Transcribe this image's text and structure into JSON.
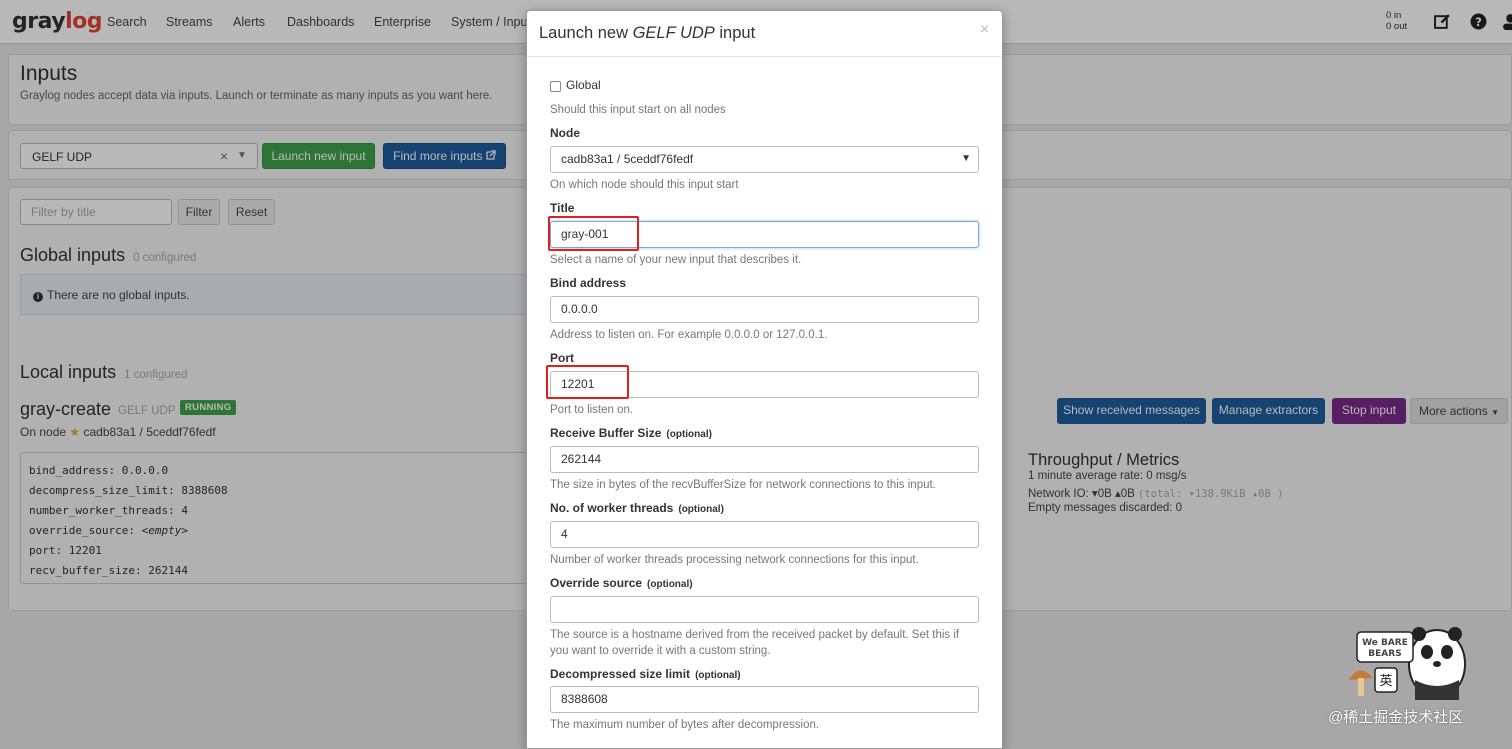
{
  "navbar": {
    "logo_gray": "gray",
    "logo_log": "log",
    "items": [
      "Search",
      "Streams",
      "Alerts",
      "Dashboards",
      "Enterprise",
      "System / Inputs"
    ],
    "throughput_in": "0 in",
    "throughput_out": "0 out",
    "icons": [
      "edit-icon",
      "help-icon",
      "user-icon"
    ]
  },
  "page": {
    "title": "Inputs",
    "description": "Graylog nodes accept data via inputs. Launch or terminate as many inputs as you want here."
  },
  "launcher": {
    "selected_input": "GELF UDP",
    "clear_glyph": "×",
    "launch_label": "Launch new input",
    "find_label": "Find more inputs"
  },
  "filter": {
    "placeholder": "Filter by title",
    "filter_label": "Filter",
    "reset_label": "Reset"
  },
  "global_inputs": {
    "title": "Global inputs",
    "count": "0 configured",
    "empty_message": "There are no global inputs."
  },
  "local_inputs": {
    "title": "Local inputs",
    "count": "1 configured"
  },
  "input": {
    "name": "gray-create",
    "type": "GELF UDP",
    "status": "RUNNING",
    "on_node_prefix": "On node",
    "node": "cadb83a1 / 5ceddf76fedf",
    "config": [
      {
        "text": "bind_address: 0.0.0.0"
      },
      {
        "text": "decompress_size_limit: 8388608"
      },
      {
        "text": "number_worker_threads: 4"
      },
      {
        "text": "override_source: ",
        "italic": "<empty>"
      },
      {
        "text": "port: 12201"
      },
      {
        "text": "recv_buffer_size: 262144"
      }
    ],
    "actions": {
      "show": "Show received messages",
      "extractors": "Manage extractors",
      "stop": "Stop input",
      "more": "More actions"
    },
    "metrics": {
      "title": "Throughput / Metrics",
      "rate": "1 minute average rate: 0 msg/s",
      "network_io_label": "Network IO:",
      "network_io_down": "0B",
      "network_io_up": "0B",
      "network_io_total": "(total: ▾138.9KiB ▴0B )",
      "discarded": "Empty messages discarded: 0"
    }
  },
  "modal": {
    "title_prefix": "Launch new ",
    "title_em": "GELF UDP",
    "title_suffix": " input",
    "close_glyph": "×",
    "global_label": "Global",
    "global_checked": false,
    "global_help": "Should this input start on all nodes",
    "node_label": "Node",
    "node_value": "cadb83a1 / 5ceddf76fedf",
    "node_help": "On which node should this input start",
    "title_label": "Title",
    "title_value": "gray-001",
    "title_help": "Select a name of your new input that describes it.",
    "bind_label": "Bind address",
    "bind_value": "0.0.0.0",
    "bind_help": "Address to listen on. For example 0.0.0.0 or 127.0.0.1.",
    "port_label": "Port",
    "port_value": "12201",
    "port_help": "Port to listen on.",
    "recv_label": "Receive Buffer Size",
    "recv_value": "262144",
    "recv_help": "The size in bytes of the recvBufferSize for network connections to this input.",
    "workers_label": "No. of worker threads",
    "workers_value": "4",
    "workers_help": "Number of worker threads processing network connections for this input.",
    "override_label": "Override source",
    "override_value": "",
    "override_help": "The source is a hostname derived from the received packet by default. Set this if you want to override it with a custom string.",
    "decomp_label": "Decompressed size limit",
    "decomp_value": "8388608",
    "decomp_help": "The maximum number of bytes after decompression.",
    "optional_tag": "(optional)"
  },
  "watermark": {
    "text": "@稀土掘金技术社区",
    "logo_text": "We BARE BEARS",
    "badge_char": "英"
  },
  "colors": {
    "success": "#3fa34d",
    "primary": "#1f5d9f",
    "stop": "#7a2a8a",
    "logo_red": "#e0453a",
    "highlight": "#e02020"
  }
}
